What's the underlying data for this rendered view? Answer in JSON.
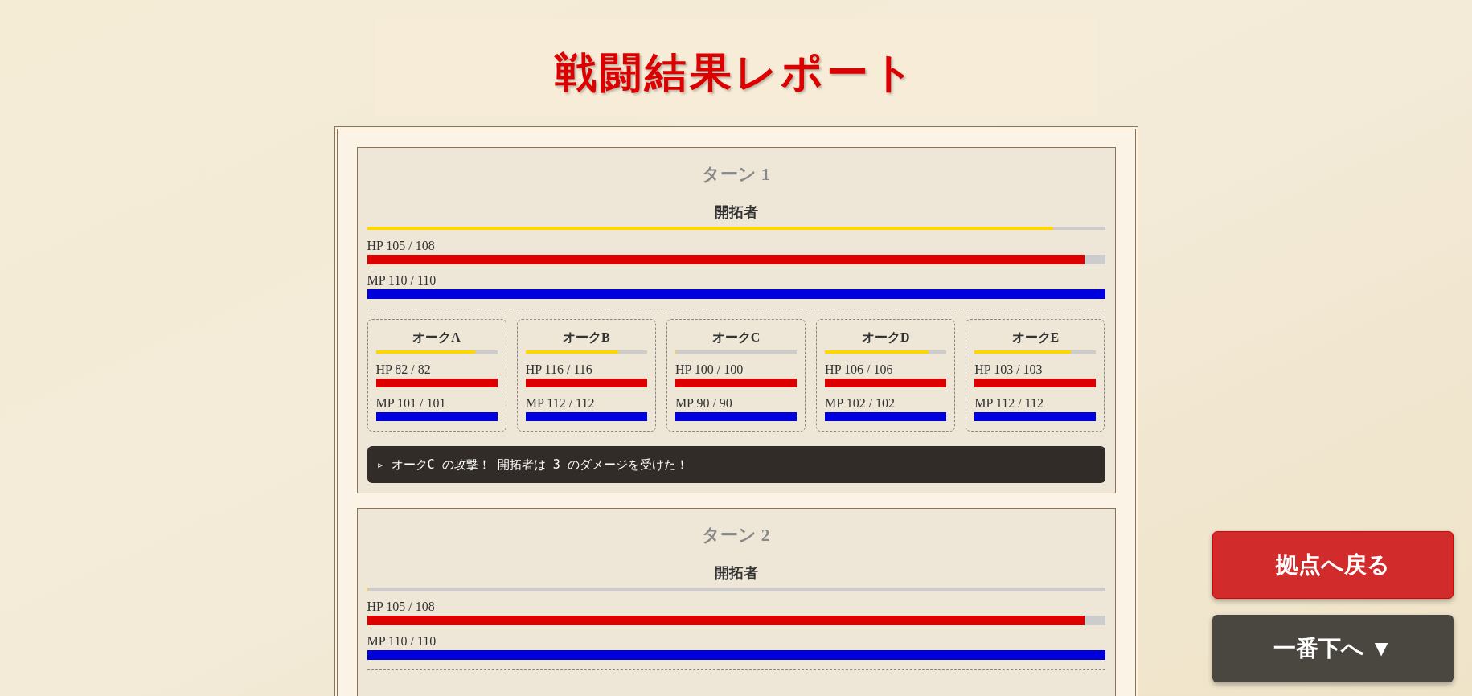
{
  "title": "戦闘結果レポート",
  "turns": [
    {
      "title": "ターン 1",
      "player": {
        "name": "開拓者",
        "gauge": {
          "level": 0.93
        },
        "hp": {
          "label": "HP 105 / 108",
          "level": 0.972
        },
        "mp": {
          "label": "MP 110 / 110",
          "level": 1
        }
      },
      "enemies": [
        {
          "name": "オークA",
          "gauge": {
            "level": 0.82
          },
          "hp": {
            "label": "HP 82 / 82",
            "level": 1
          },
          "mp": {
            "label": "MP 101 / 101",
            "level": 1
          }
        },
        {
          "name": "オークB",
          "gauge": {
            "level": 0.76
          },
          "hp": {
            "label": "HP 116 / 116",
            "level": 1
          },
          "mp": {
            "label": "MP 112 / 112",
            "level": 1
          }
        },
        {
          "name": "オークC",
          "gauge": {
            "level": 0
          },
          "hp": {
            "label": "HP 100 / 100",
            "level": 1
          },
          "mp": {
            "label": "MP 90 / 90",
            "level": 1
          }
        },
        {
          "name": "オークD",
          "gauge": {
            "level": 0.85
          },
          "hp": {
            "label": "HP 106 / 106",
            "level": 1
          },
          "mp": {
            "label": "MP 102 / 102",
            "level": 1
          }
        },
        {
          "name": "オークE",
          "gauge": {
            "level": 0.79
          },
          "hp": {
            "label": "HP 103 / 103",
            "level": 1
          },
          "mp": {
            "label": "MP 112 / 112",
            "level": 1
          }
        }
      ],
      "log": [
        "▹ オークC の攻撃！ 開拓者は 3 のダメージを受けた！"
      ]
    },
    {
      "title": "ターン 2",
      "player": {
        "name": "開拓者",
        "gauge": {
          "level": 0
        },
        "hp": {
          "label": "HP 105 / 108",
          "level": 0.972
        },
        "mp": {
          "label": "MP 110 / 110",
          "level": 1
        }
      }
    }
  ],
  "buttons": [
    {
      "label": "拠点へ戻る",
      "kind": "primary"
    },
    {
      "label": "一番下へ ▼",
      "kind": "secondary"
    }
  ]
}
